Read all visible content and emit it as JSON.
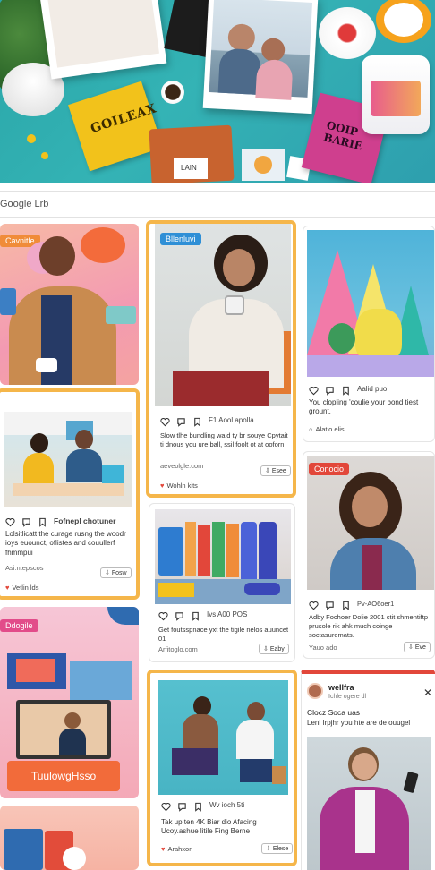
{
  "hero": {
    "yellow_book_text": "GOILEAX",
    "pink_box_text": "OOIP BARIE",
    "white_card_text": "LAIN"
  },
  "search": {
    "placeholder": "Google Lrb"
  },
  "cards": {
    "c1": {
      "tag": "Cavnitle",
      "tag_color": "#f08c39"
    },
    "c2": {
      "title": "Fofnepl chotuner",
      "caption": "Lolsitlicatt the curage rusng the woodr ioys euounct, oflistes and couullerf fhmmpui",
      "link": "Asi.ntepscos",
      "save": "Fosw",
      "foot": "Vetlin lds"
    },
    "c3": {
      "tag": "Ddogile",
      "tag_color": "#e24c8a",
      "cta": "TuulowgHsso"
    },
    "c4": {
      "tag": "Bllenluvi",
      "tag_color": "#2f8fd6",
      "title": "F1 Aool apolla",
      "caption": "Slow tlhe bundling wald ty br souye Cpytait ti dnous you ure ball, ssil foolt ot at ooforn",
      "link": "aeveolgle.com",
      "save": "Esee",
      "foot": "Wohln kits"
    },
    "c5": {
      "title": "Ivs A00 POS",
      "caption": "Get foutsspnace yxt the tigile nelos auuncet 01",
      "link": "Arfitoglo.com",
      "save": "Eaby"
    },
    "c6": {
      "title": "Wv ioch 5ti",
      "caption": "Tak up ten 4K Biar dio Afacing Ucoy.ashue litile Fing Berne",
      "link": "Arahxon",
      "save": "Elese"
    },
    "c7": {
      "title": "Aalid puo",
      "caption": "You clopling 'coulie your bond tiest grount.",
      "foot": "Alatio elis"
    },
    "c8": {
      "tag": "Conocio",
      "tag_color": "#e2473a",
      "title": "Pv-AO6oer1",
      "caption": "Adby Fochoer Dolie 2001 ctit shmentiftp prusole rik ahk much coinge soctasuremats.",
      "link": "Yauo ado",
      "save": "Eve"
    },
    "c9": {
      "name": "wellfra",
      "sub": "Ichle ogere dl",
      "title": "Clocz Soca uas",
      "caption": "Lenl Irpjhr you hte are de ouugel"
    }
  }
}
